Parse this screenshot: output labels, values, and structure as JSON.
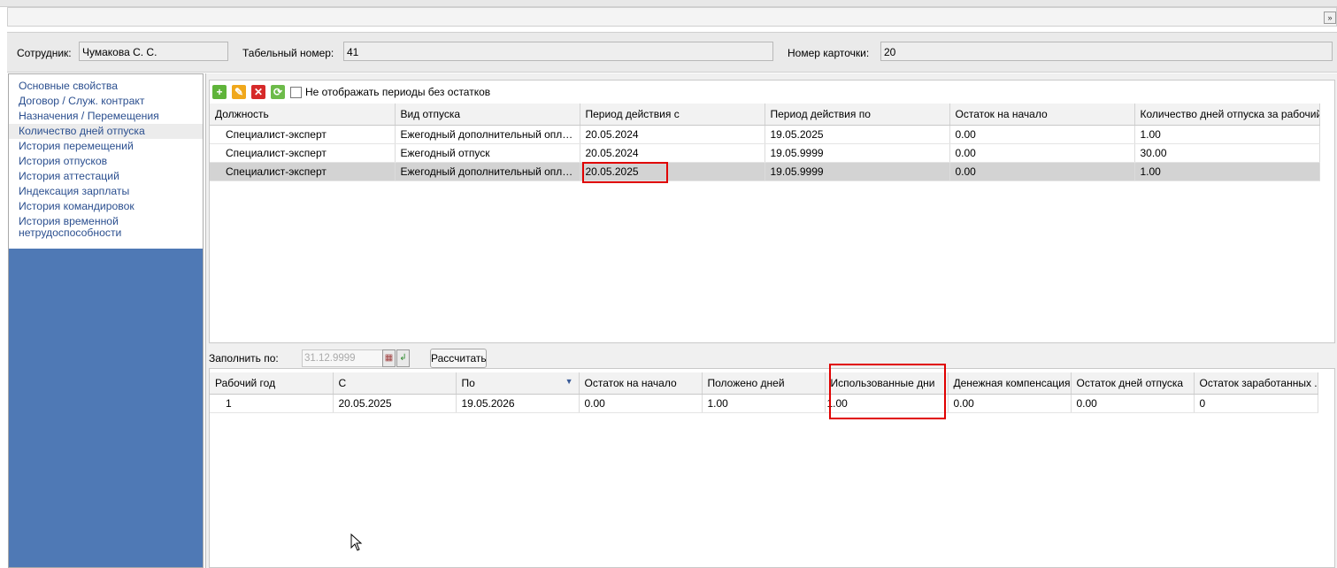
{
  "header": {
    "employee_label": "Сотрудник:",
    "employee_value": "Чумакова С. С.",
    "tab_no_label": "Табельный номер:",
    "tab_no_value": "41",
    "card_no_label": "Номер карточки:",
    "card_no_value": "20",
    "collapse_icon": "double-chevron-right-icon"
  },
  "sidebar": {
    "items": [
      {
        "label": "Основные свойства"
      },
      {
        "label": "Договор / Служ. контракт"
      },
      {
        "label": "Назначения / Перемещения"
      },
      {
        "label": "Количество дней отпуска"
      },
      {
        "label": "История перемещений"
      },
      {
        "label": "История отпусков"
      },
      {
        "label": "История аттестаций"
      },
      {
        "label": "Индексация зарплаты"
      },
      {
        "label": "История командировок"
      },
      {
        "label": "История временной нетрудоспособности"
      }
    ],
    "active_index": 3
  },
  "toolbar": {
    "buttons": [
      "add-icon",
      "edit-icon",
      "delete-icon",
      "refresh-icon"
    ],
    "hide_periods_label": "Не отображать периоды без остатков",
    "hide_periods_checked": false
  },
  "top_grid": {
    "columns": [
      "Должность",
      "Вид отпуска",
      "Период действия с",
      "Период действия по",
      "Остаток на начало",
      "Количество дней отпуска за рабочий..."
    ],
    "rows": [
      [
        "Специалист-эксперт",
        "Ежегодный дополнительный оплачи...",
        "20.05.2024",
        "19.05.2025",
        "0.00",
        "1.00"
      ],
      [
        "Специалист-эксперт",
        "Ежегодный отпуск",
        "20.05.2024",
        "19.05.9999",
        "0.00",
        "30.00"
      ],
      [
        "Специалист-эксперт",
        "Ежегодный дополнительный оплачи...",
        "20.05.2025",
        "19.05.9999",
        "0.00",
        "1.00"
      ]
    ],
    "selected_row": 2
  },
  "fill": {
    "label": "Заполнить по:",
    "date_value": "31.12.9999",
    "calc_label": "Рассчитать"
  },
  "bottom_grid": {
    "columns": [
      "Рабочий год",
      "С",
      "По",
      "Остаток на начало",
      "Положено дней",
      "Использованные дни",
      "Денежная компенсация",
      "Остаток дней отпуска",
      "Остаток заработанных ..."
    ],
    "rows": [
      [
        "1",
        "20.05.2025",
        "19.05.2026",
        "0.00",
        "1.00",
        "1.00",
        "0.00",
        "0.00",
        "0"
      ]
    ]
  },
  "colors": {
    "sidebar_bg": "#4f79b5",
    "sidebar_text": "#2b4f8f",
    "highlight": "#e00000",
    "selected_row": "#d3d3d3"
  }
}
